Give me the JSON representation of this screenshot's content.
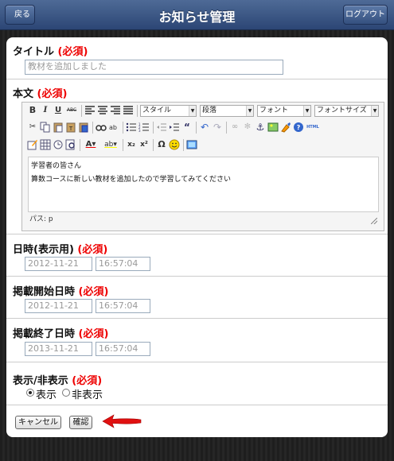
{
  "header": {
    "title": "お知らせ管理",
    "back_label": "戻る",
    "logout_label": "ログアウト"
  },
  "required_mark": "(必須)",
  "title_field": {
    "label": "タイトル",
    "value": "教材を追加しました"
  },
  "body_field": {
    "label": "本文",
    "toolbar": {
      "row1": [
        "bold-icon",
        "italic-icon",
        "underline-icon",
        "strikethrough-icon",
        "align-left-icon",
        "align-center-icon",
        "align-right-icon",
        "align-justify-icon"
      ],
      "style_select": "スタイル",
      "format_select": "段落",
      "font_select": "フォント",
      "fontsize_select": "フォントサイズ",
      "row2": [
        "cut-icon",
        "copy-icon",
        "paste-icon",
        "paste-text-icon",
        "paste-word-icon",
        "find-icon",
        "replace-icon",
        "bullet-list-icon",
        "numbered-list-icon",
        "outdent-icon",
        "indent-icon",
        "blockquote-icon",
        "undo-icon",
        "redo-icon",
        "link-icon",
        "unlink-icon",
        "anchor-icon",
        "image-icon",
        "cleanup-icon",
        "help-icon",
        "html-icon"
      ],
      "row3": [
        "edit-icon",
        "table-icon",
        "datetime-icon",
        "preview-icon",
        "text-color-icon",
        "highlight-color-icon",
        "subscript-icon",
        "superscript-icon",
        "charmap-icon",
        "emoticon-icon",
        "media-icon"
      ]
    },
    "content_lines": [
      "学習者の皆さん",
      "算数コースに新しい教材を追加したので学習してみてください"
    ],
    "status_path": "パス: p"
  },
  "datetime_display": {
    "label": "日時(表示用)",
    "date": "2012-11-21",
    "time": "16:57:04"
  },
  "publish_start": {
    "label": "掲載開始日時",
    "date": "2012-11-21",
    "time": "16:57:04"
  },
  "publish_end": {
    "label": "掲載終了日時",
    "date": "2013-11-21",
    "time": "16:57:04"
  },
  "visibility": {
    "label": "表示/非表示",
    "options": [
      "表示",
      "非表示"
    ],
    "selected": "表示"
  },
  "buttons": {
    "cancel": "キャンセル",
    "confirm": "確認"
  },
  "colors": {
    "header": "#34507f",
    "required": "#ee0000",
    "arrow": "#e01010"
  }
}
